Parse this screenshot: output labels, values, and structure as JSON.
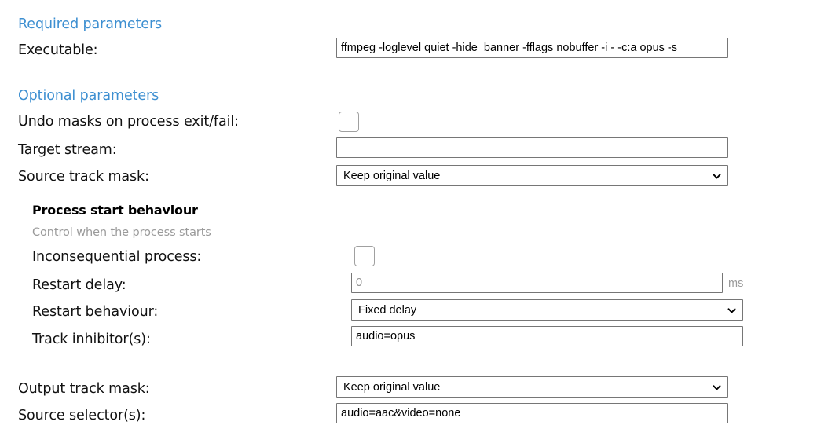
{
  "sections": {
    "required": {
      "heading": "Required parameters",
      "fields": [
        {
          "label": "Executable:",
          "value": "ffmpeg -loglevel quiet -hide_banner -fflags nobuffer -i - -c:a opus -s",
          "placeholder": ""
        }
      ]
    },
    "optional": {
      "heading": "Optional parameters",
      "undo_masks_label": "Undo masks on process exit/fail:",
      "undo_masks_checked": false,
      "target_stream_label": "Target stream:",
      "target_stream_value": "",
      "target_stream_placeholder": "",
      "source_track_mask_label": "Source track mask:",
      "source_track_mask_value": "Keep original value",
      "source_track_mask_options": [
        "Keep original value"
      ],
      "output_track_mask_label": "Output track mask:",
      "output_track_mask_value": "Keep original value",
      "output_track_mask_options": [
        "Keep original value"
      ],
      "source_selectors_label": "Source selector(s):",
      "source_selectors_value": "audio=aac&video=none",
      "source_selectors_placeholder": ""
    },
    "process_start": {
      "title": "Process start behaviour",
      "subtitle": "Control when the process starts",
      "inconsequential_label": "Inconsequential process:",
      "inconsequential_checked": false,
      "restart_delay_label": "Restart delay:",
      "restart_delay_value": "",
      "restart_delay_placeholder": "0",
      "restart_delay_unit": "ms",
      "restart_behaviour_label": "Restart behaviour:",
      "restart_behaviour_value": "Fixed delay",
      "restart_behaviour_options": [
        "Fixed delay"
      ],
      "track_inhibitors_label": "Track inhibitor(s):",
      "track_inhibitors_value": "audio=opus",
      "track_inhibitors_placeholder": ""
    }
  },
  "colors": {
    "heading_blue": "#3d8fd1",
    "label_text": "#111111",
    "muted_text": "#9a9a9a",
    "control_border": "#767676",
    "checkbox_border": "#a0a0a0"
  },
  "icons": {
    "dropdown": "chevron-down-icon"
  }
}
